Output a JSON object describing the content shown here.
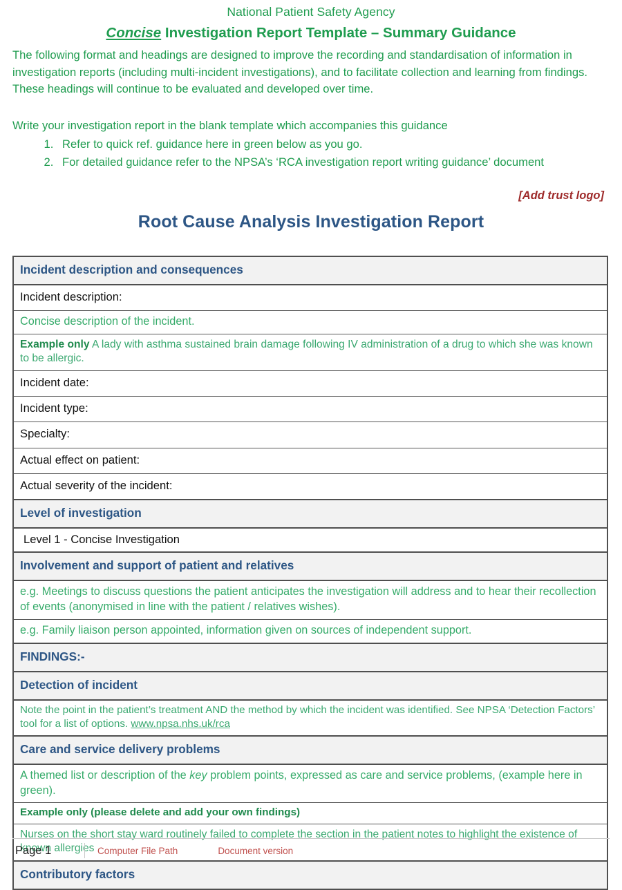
{
  "guidance": {
    "agency": "National Patient Safety Agency",
    "title_emphasis": "Concise",
    "title_rest": " Investigation Report Template – Summary Guidance",
    "paragraph": "The following format and headings are designed to improve the recording and standardisation of information in investigation reports (including multi-incident investigations), and to facilitate collection and learning from findings. These headings will continue to be evaluated and developed over time.",
    "write_line": "Write your investigation report in the blank template which accompanies this guidance",
    "list": [
      "Refer to quick ref. guidance here in green below as you go.",
      "For detailed guidance refer to the NPSA’s ‘RCA investigation report writing guidance’ document"
    ]
  },
  "trust_logo_placeholder": "[Add trust logo]",
  "report_title": "Root Cause Analysis Investigation Report",
  "table": {
    "section_incident": "Incident description and consequences",
    "incident_description_label": "Incident description:",
    "incident_description_hint": "Concise description of the incident.",
    "example_label": "Example only",
    "example_text": " A lady with asthma sustained brain damage following IV administration of a drug to which she was known to be allergic.",
    "incident_date_label": "Incident date:",
    "incident_type_label": "Incident type:",
    "specialty_label": "Specialty:",
    "actual_effect_label": "Actual effect on patient:",
    "actual_severity_label": "Actual severity of the incident:",
    "section_level": "Level of investigation",
    "level_value": "Level  1 - Concise Investigation",
    "section_involvement": "Involvement and support of patient and relatives",
    "involvement_hint_1": "e.g. Meetings to discuss questions the patient anticipates the investigation will address and to hear their recollection of events (anonymised in line with the patient / relatives wishes).",
    "involvement_hint_2": "e.g. Family liaison person appointed, information given on sources of independent support.",
    "section_findings": "FINDINGS:-",
    "section_detection": "Detection of incident",
    "detection_hint_pre": "Note the point in the patient’s treatment AND the method by which the incident was identified. See NPSA ‘Detection Factors’ tool for a list of options. ",
    "detection_link": "www.npsa.nhs.uk/rca",
    "section_care": "Care and service delivery problems",
    "care_hint_pre": "A themed list or description of the ",
    "care_hint_em": "key",
    "care_hint_post": " problem points, expressed as care and service problems, (example here in green).",
    "care_example_label": "Example only (please delete and add your own findings)",
    "care_example_text": "Nurses on the short stay ward routinely failed to complete the section in the patient notes to highlight the existence of known allergies",
    "section_contributory": "Contributory factors"
  },
  "footer": {
    "page": "Page 1",
    "file_path": "Computer File Path",
    "doc_version": "Document version"
  },
  "colors": {
    "green": "#1f9c4f",
    "green_body": "#36ab6a",
    "heading_blue": "#2d5685",
    "trust_red": "#9e2a2a",
    "footer_red": "#c0504d",
    "section_bg": "#f2f2f2"
  }
}
